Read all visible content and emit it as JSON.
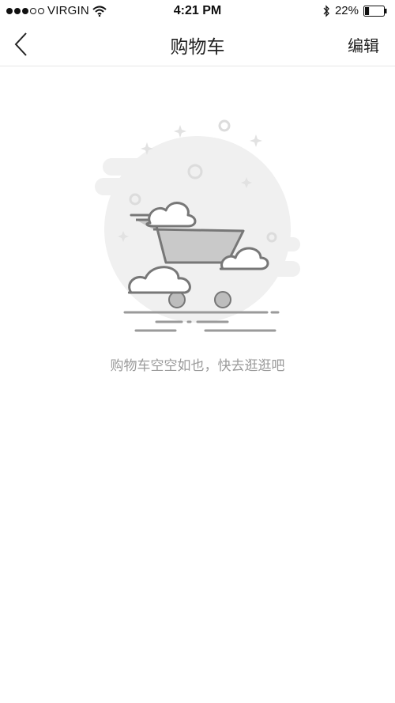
{
  "status_bar": {
    "carrier": "VIRGIN",
    "time": "4:21 PM",
    "battery": "22%",
    "signal_bars_filled": 3,
    "signal_bars_total": 5,
    "battery_level": 0.22
  },
  "nav": {
    "back_icon": "chevron-left-icon",
    "title": "购物车",
    "edit_label": "编辑"
  },
  "empty_state": {
    "illustration_icon": "empty-cart-illustration",
    "message": "购物车空空如也，快去逛逛吧"
  },
  "colors": {
    "background": "#ffffff",
    "divider": "#e6e6e6",
    "message_text": "#9a9a9a",
    "illustration_gray": "#cfcfcf"
  }
}
